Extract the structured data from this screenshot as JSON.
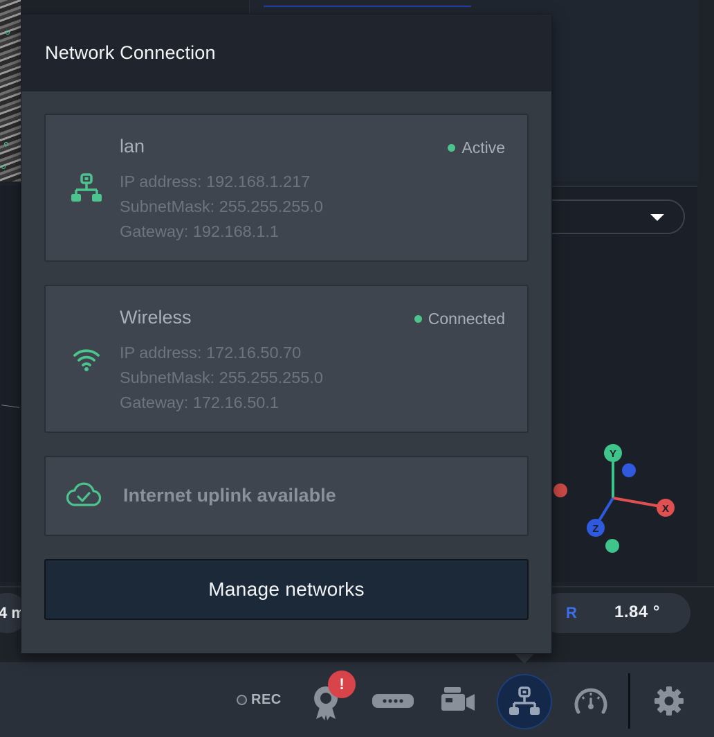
{
  "popover": {
    "title": "Network Connection",
    "networks": [
      {
        "name": "lan",
        "status": "Active",
        "icon": "lan-icon",
        "ip_line": "IP address: 192.168.1.217",
        "subnet_line": "SubnetMask: 255.255.255.0",
        "gateway_line": "Gateway: 192.168.1.1"
      },
      {
        "name": "Wireless",
        "status": "Connected",
        "icon": "wifi-icon",
        "ip_line": "IP address: 172.16.50.70",
        "subnet_line": "SubnetMask: 255.255.255.0",
        "gateway_line": "Gateway: 172.16.50.1"
      }
    ],
    "uplink": {
      "icon": "cloud-check-icon",
      "label": "Internet uplink available"
    },
    "manage_button": "Manage networks"
  },
  "background": {
    "rotation_label": "R",
    "rotation_value": "1.84 °",
    "left_value_fragment": "4 m",
    "axis_labels": {
      "x": "X",
      "y": "Y",
      "z": "Z"
    }
  },
  "toolbar": {
    "rec_label": "REC",
    "alert_badge": "!",
    "icons": [
      "award-icon",
      "sensor-icon",
      "camera-icon",
      "network-icon",
      "gauge-icon",
      "gear-icon"
    ]
  },
  "colors": {
    "accent_green": "#4cc48e",
    "popover_bg": "#353b43",
    "header_bg": "#20252d",
    "card_bg": "#3f454e",
    "button_bg": "#1b2939",
    "alert_red": "#d9444a",
    "axis_x": "#e05050",
    "axis_y": "#3fc48c",
    "axis_z": "#2f5ae0"
  }
}
